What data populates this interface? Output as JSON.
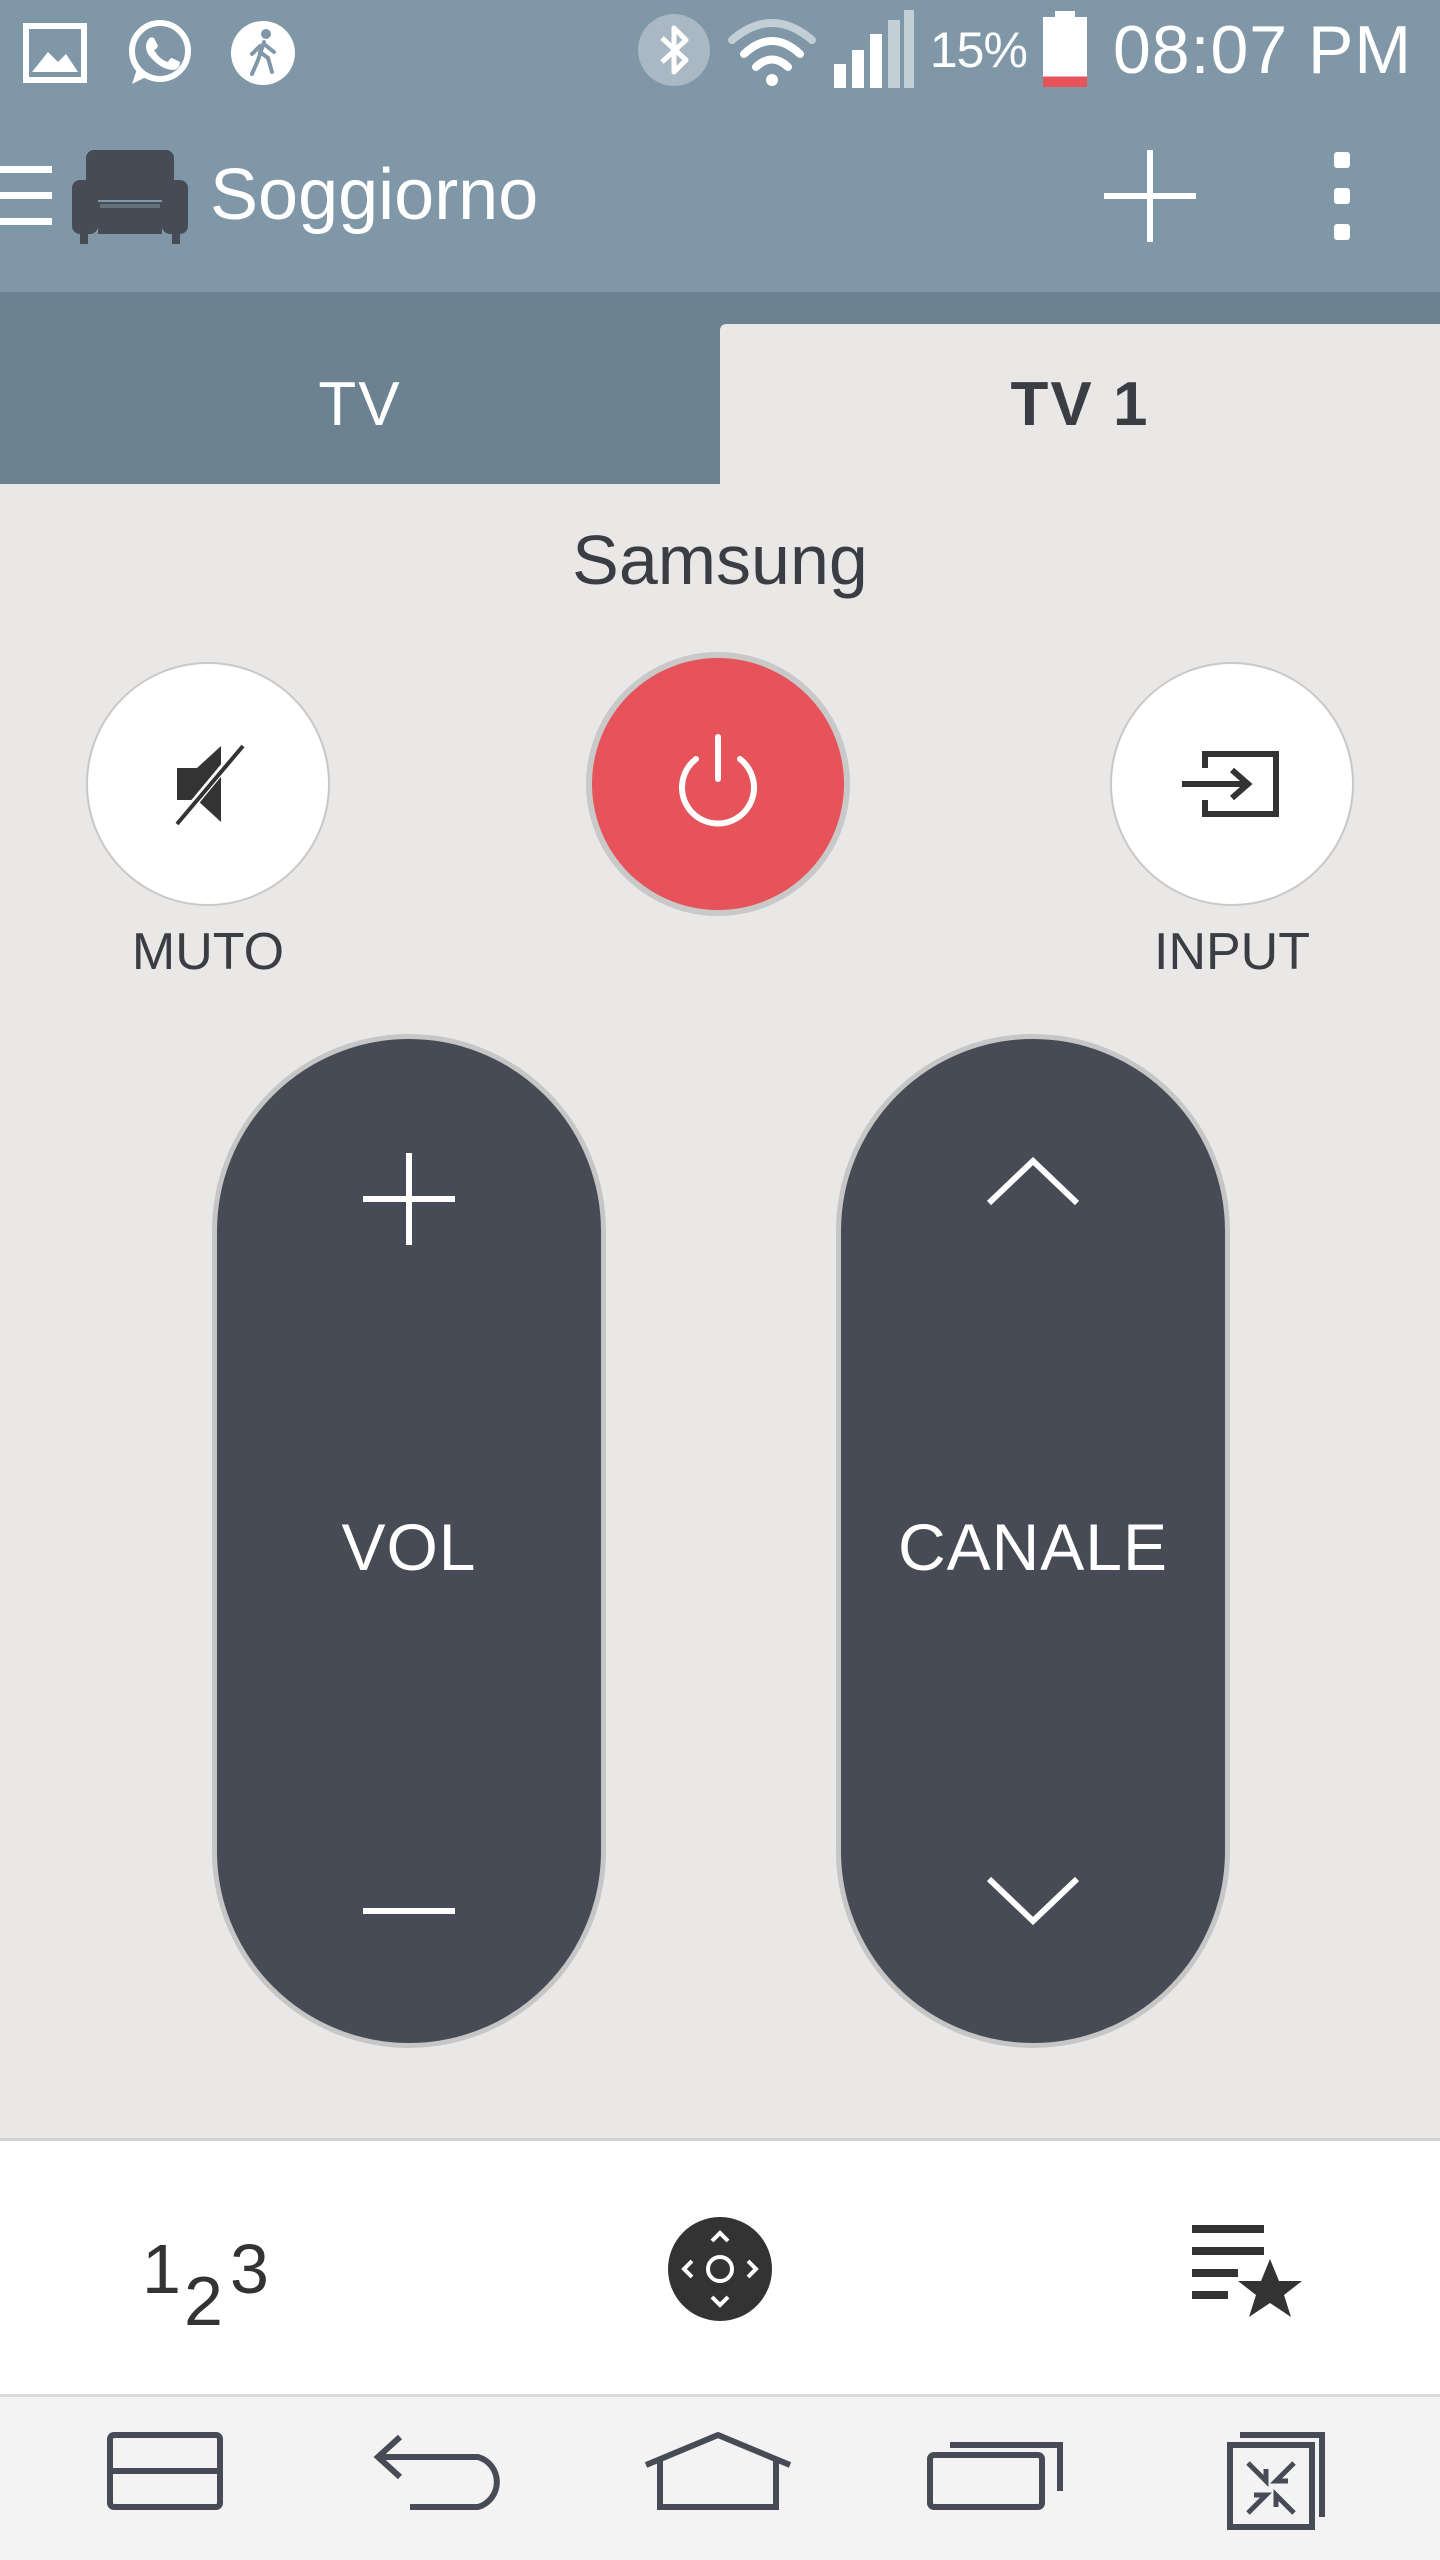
{
  "status_bar": {
    "battery_percent": "15%",
    "time": "08:07 PM",
    "icons": [
      "gallery-icon",
      "whatsapp-icon",
      "walking-icon",
      "bluetooth-icon",
      "wifi-icon",
      "signal-icon",
      "battery-icon"
    ],
    "battery_level": 0.15
  },
  "app_bar": {
    "room_name": "Soggiorno",
    "icons": [
      "menu-icon",
      "sofa-icon",
      "add-icon",
      "more-options-icon"
    ]
  },
  "tabs": [
    {
      "label": "TV",
      "selected": false
    },
    {
      "label": "TV 1",
      "selected": true
    }
  ],
  "remote": {
    "brand": "Samsung",
    "mute_label": "MUTO",
    "input_label": "INPUT",
    "volume_label": "VOL",
    "channel_label": "CANALE",
    "power_color": "#e6535a"
  },
  "bottom_sheet": {
    "numpad_digits": [
      "1",
      "2",
      "3"
    ],
    "icons": [
      "numpad-icon",
      "dpad-icon",
      "favorites-icon"
    ]
  },
  "nav_bar": {
    "icons": [
      "dual-window-icon",
      "back-icon",
      "home-icon",
      "recent-apps-icon",
      "mini-view-icon"
    ]
  },
  "colors": {
    "header": "#7f97a6",
    "tab_bar": "#6c8291",
    "background": "#e9e8e7",
    "pill": "#474b55"
  }
}
